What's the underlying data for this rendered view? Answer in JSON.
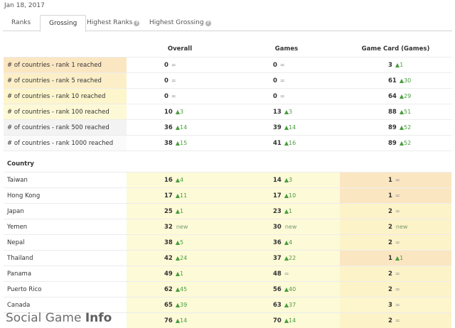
{
  "date": "Jan 18, 2017",
  "tabs": [
    {
      "label": "Ranks",
      "active": false,
      "info": false
    },
    {
      "label": "Grossing",
      "active": true,
      "info": false
    },
    {
      "label": "Highest Ranks",
      "active": false,
      "info": true
    },
    {
      "label": "Highest Grossing",
      "active": false,
      "info": true
    }
  ],
  "columns": [
    "Overall",
    "Games",
    "Game Card (Games)"
  ],
  "summary_rows": [
    {
      "label": "# of countries - rank 1 reached",
      "bg": "#fbe6c2",
      "cells": [
        {
          "v": "0",
          "d": "=",
          "t": "eq"
        },
        {
          "v": "0",
          "d": "=",
          "t": "eq"
        },
        {
          "v": "3",
          "d": "▲1",
          "t": "up"
        }
      ]
    },
    {
      "label": "# of countries - rank 5 reached",
      "bg": "#fcefc8",
      "cells": [
        {
          "v": "0",
          "d": "=",
          "t": "eq"
        },
        {
          "v": "0",
          "d": "=",
          "t": "eq"
        },
        {
          "v": "61",
          "d": "▲30",
          "t": "up"
        }
      ]
    },
    {
      "label": "# of countries - rank 10 reached",
      "bg": "#fdf5cc",
      "cells": [
        {
          "v": "0",
          "d": "=",
          "t": "eq"
        },
        {
          "v": "0",
          "d": "=",
          "t": "eq"
        },
        {
          "v": "64",
          "d": "▲29",
          "t": "up"
        }
      ]
    },
    {
      "label": "# of countries - rank 100 reached",
      "bg": "#fdf9d6",
      "cells": [
        {
          "v": "10",
          "d": "▲3",
          "t": "up"
        },
        {
          "v": "13",
          "d": "▲3",
          "t": "up"
        },
        {
          "v": "88",
          "d": "▲51",
          "t": "up"
        }
      ]
    },
    {
      "label": "# of countries - rank 500 reached",
      "bg": "#f3f3f3",
      "cells": [
        {
          "v": "36",
          "d": "▲14",
          "t": "up"
        },
        {
          "v": "39",
          "d": "▲14",
          "t": "up"
        },
        {
          "v": "89",
          "d": "▲52",
          "t": "up"
        }
      ]
    },
    {
      "label": "# of countries - rank 1000 reached",
      "bg": "#fafafa",
      "cells": [
        {
          "v": "38",
          "d": "▲15",
          "t": "up"
        },
        {
          "v": "41",
          "d": "▲16",
          "t": "up"
        },
        {
          "v": "89",
          "d": "▲52",
          "t": "up"
        }
      ]
    }
  ],
  "country_header": "Country",
  "countries": [
    {
      "name": "Taiwan",
      "cells": [
        {
          "v": "16",
          "d": "▲4",
          "t": "up"
        },
        {
          "v": "14",
          "d": "▲3",
          "t": "up"
        },
        {
          "v": "1",
          "d": "=",
          "t": "eq"
        }
      ],
      "bg3": "#fbe6c2"
    },
    {
      "name": "Hong Kong",
      "cells": [
        {
          "v": "17",
          "d": "▲11",
          "t": "up"
        },
        {
          "v": "17",
          "d": "▲10",
          "t": "up"
        },
        {
          "v": "1",
          "d": "=",
          "t": "eq"
        }
      ],
      "bg3": "#fbe6c2"
    },
    {
      "name": "Japan",
      "cells": [
        {
          "v": "25",
          "d": "▲1",
          "t": "up"
        },
        {
          "v": "23",
          "d": "▲1",
          "t": "up"
        },
        {
          "v": "2",
          "d": "=",
          "t": "eq"
        }
      ],
      "bg3": "#fdf3c9"
    },
    {
      "name": "Yemen",
      "cells": [
        {
          "v": "32",
          "d": "new",
          "t": "new"
        },
        {
          "v": "30",
          "d": "new",
          "t": "new"
        },
        {
          "v": "2",
          "d": "new",
          "t": "new"
        }
      ],
      "bg3": "#fdf3c9"
    },
    {
      "name": "Nepal",
      "cells": [
        {
          "v": "38",
          "d": "▲5",
          "t": "up"
        },
        {
          "v": "36",
          "d": "▲4",
          "t": "up"
        },
        {
          "v": "2",
          "d": "=",
          "t": "eq"
        }
      ],
      "bg3": "#fdf3c9"
    },
    {
      "name": "Thailand",
      "cells": [
        {
          "v": "42",
          "d": "▲24",
          "t": "up"
        },
        {
          "v": "37",
          "d": "▲22",
          "t": "up"
        },
        {
          "v": "1",
          "d": "▲1",
          "t": "up"
        }
      ],
      "bg3": "#fbe6c2"
    },
    {
      "name": "Panama",
      "cells": [
        {
          "v": "49",
          "d": "▲1",
          "t": "up"
        },
        {
          "v": "48",
          "d": "=",
          "t": "eq"
        },
        {
          "v": "2",
          "d": "=",
          "t": "eq"
        }
      ],
      "bg3": "#fdf3c9"
    },
    {
      "name": "Puerto Rico",
      "cells": [
        {
          "v": "62",
          "d": "▲45",
          "t": "up"
        },
        {
          "v": "56",
          "d": "▲40",
          "t": "up"
        },
        {
          "v": "2",
          "d": "=",
          "t": "eq"
        }
      ],
      "bg3": "#fdf3c9"
    },
    {
      "name": "Canada",
      "cells": [
        {
          "v": "65",
          "d": "▲39",
          "t": "up"
        },
        {
          "v": "63",
          "d": "▲37",
          "t": "up"
        },
        {
          "v": "3",
          "d": "=",
          "t": "eq"
        }
      ],
      "bg3": "#fdf5cc"
    },
    {
      "name": "",
      "cells": [
        {
          "v": "76",
          "d": "▲14",
          "t": "up"
        },
        {
          "v": "70",
          "d": "▲14",
          "t": "up"
        },
        {
          "v": "2",
          "d": "=",
          "t": "eq"
        }
      ],
      "bg3": "#fdf3c9"
    }
  ],
  "watermark": {
    "light": "Social Game ",
    "bold": "Info"
  },
  "colors": {
    "up": "#4a9d3e",
    "country_cell_bg": "#fdfad8",
    "border": "#ececec"
  }
}
